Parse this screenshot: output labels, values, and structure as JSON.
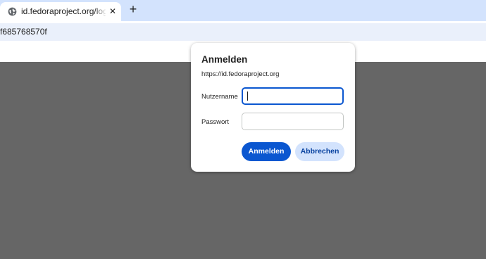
{
  "browser": {
    "tab": {
      "title": "id.fedoraproject.org/login/gssapi",
      "favicon": "globe-icon",
      "close_glyph": "✕"
    },
    "new_tab_glyph": "+",
    "address_text": "f685768570f"
  },
  "colors": {
    "tabstrip": "#d3e3fd",
    "page_overlay": "#666666",
    "primary_button": "#0b57d0",
    "secondary_button": "#d3e3fd"
  },
  "dialog": {
    "title": "Anmelden",
    "origin": "https://id.fedoraproject.org",
    "username": {
      "label": "Nutzername",
      "value": ""
    },
    "password": {
      "label": "Passwort",
      "value": ""
    },
    "buttons": {
      "sign_in": "Anmelden",
      "cancel": "Abbrechen"
    }
  }
}
